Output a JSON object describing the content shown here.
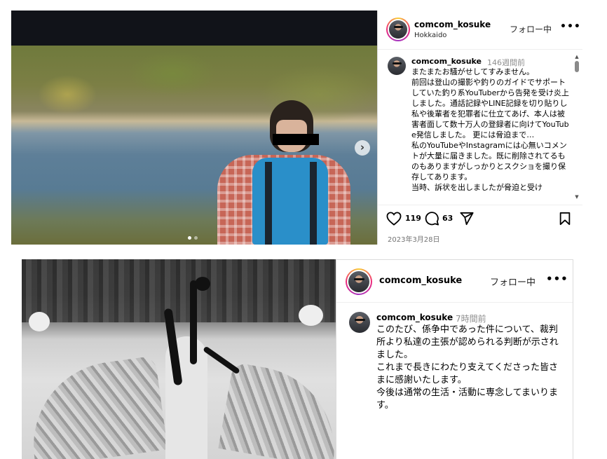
{
  "post1": {
    "username": "comcom_kosuke",
    "location": "Hokkaido",
    "follow_label": "フォロー中",
    "more_label": "•••",
    "next_label": "›",
    "caption_user": "comcom_kosuke",
    "caption_time": "146週間前",
    "caption_text": "またまたお騒がせしてすみません。\n前回は登山の撮影や釣りのガイドでサポートしていた釣り系YouTuberから告発を受け炎上しました。通話記録やLINE記録を切り貼りし私や後輩者を犯罪者に仕立てあげ、本人は被害者面して数十万人の登録者に向けてYouTube発信しました。 更には脅迫まで…\n私のYouTubeやInstagramには心無いコメントが大量に届きました。既に削除されてるものもありますがしっかりとスクショを撮り保存してあります。\n当時、訴状を出しましたが脅迫と受け",
    "likes": "119",
    "comments": "63",
    "date": "2023年3月28日",
    "icons": [
      "heart-icon",
      "comment-icon",
      "share-icon",
      "bookmark-icon"
    ]
  },
  "post2": {
    "username": "comcom_kosuke",
    "follow_label": "フォロー中",
    "more_label": "•••",
    "caption_user": "comcom_kosuke",
    "caption_time": "7時間前",
    "caption_text": "このたび、係争中であった件について、裁判所より私達の主張が認められる判断が示されました。\nこれまで長きにわたり支えてくださった皆さまに感謝いたします。\n今後は通常の生活・活動に専念してまいります。"
  }
}
